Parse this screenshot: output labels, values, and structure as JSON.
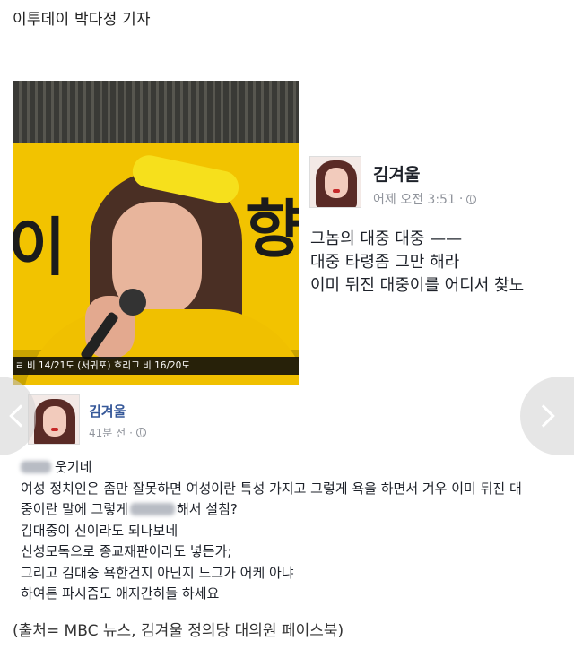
{
  "byline": "이투데이 박다정 기자",
  "broadcast": {
    "ticker": "ㄹ 비 14/21도 (서귀포) 흐리고 비 16/20도",
    "sign_left": "이",
    "sign_right": "향"
  },
  "post1": {
    "name": "김겨울",
    "time": "어제 오전 3:51",
    "separator": "·",
    "lines": [
      "그놈의 대중 대중 ——",
      "대중 타령좀 그만 해라",
      "이미 뒤진 대중이를 어디서 찾노"
    ]
  },
  "post2": {
    "name": "김겨울",
    "time": "41분 전",
    "separator": "·",
    "line1_suffix": "웃기네",
    "line2": "여성 정치인은 좀만 잘못하면 여성이란 특성 가지고 그렇게 욕을 하면서 겨우 이미 뒤진 대",
    "line3_prefix": "중이란 말에 그렇게",
    "line3_suffix": "해서 설침?",
    "line4": "김대중이 신이라도 되나보네",
    "line5": "신성모독으로 종교재판이라도 넣든가;",
    "line6": "그리고 김대중 욕한건지 아닌지 느그가 어케 아냐",
    "line7": "하여튼 파시즘도 애지간히들 하세요"
  },
  "caption": "(출처= MBC 뉴스, 김겨울 정의당 대의원 페이스북)",
  "icons": {
    "globe": "globe-icon",
    "prev": "chevron-left-icon",
    "next": "chevron-right-icon"
  }
}
